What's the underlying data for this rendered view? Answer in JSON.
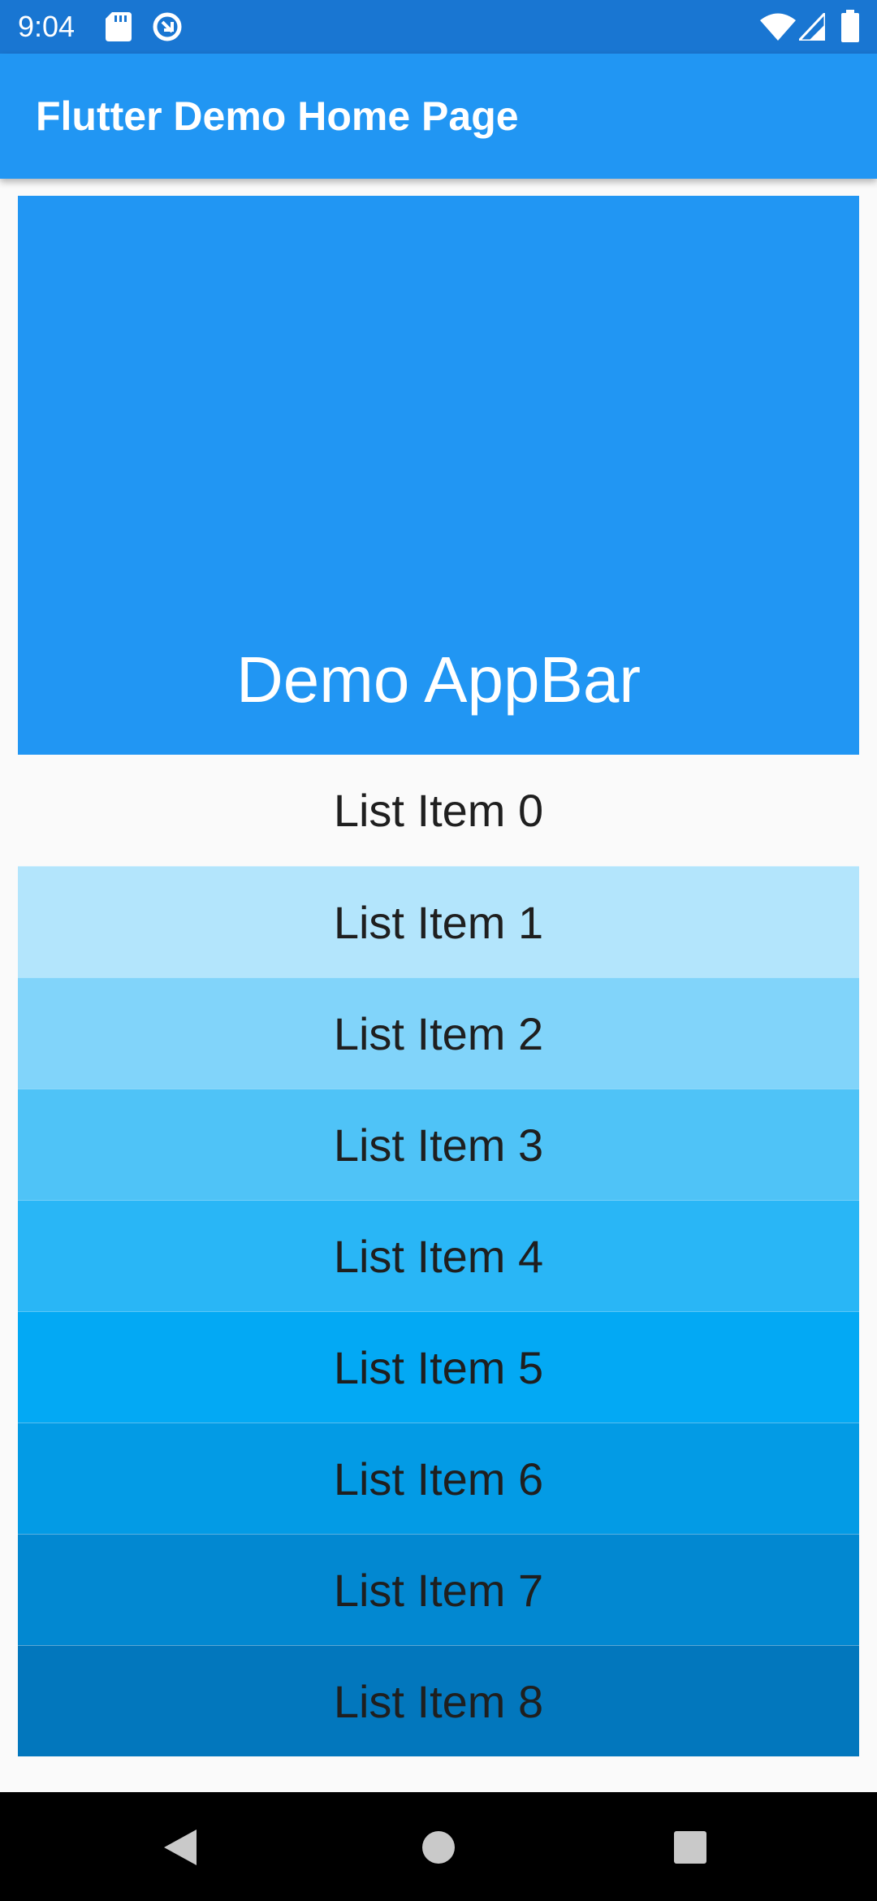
{
  "status_bar": {
    "time": "9:04",
    "icons": [
      "sd-card-icon",
      "data-saver-icon",
      "wifi-icon",
      "signal-icon",
      "battery-icon"
    ]
  },
  "app_bar": {
    "title": "Flutter Demo Home Page"
  },
  "header": {
    "title": "Demo AppBar"
  },
  "list": {
    "items": [
      {
        "label": "List Item 0",
        "color": "#fafafa"
      },
      {
        "label": "List Item 1",
        "color": "#b3e5fc"
      },
      {
        "label": "List Item 2",
        "color": "#81d4fa"
      },
      {
        "label": "List Item 3",
        "color": "#4fc3f7"
      },
      {
        "label": "List Item 4",
        "color": "#29b6f6"
      },
      {
        "label": "List Item 5",
        "color": "#03a9f4"
      },
      {
        "label": "List Item 6",
        "color": "#039be5"
      },
      {
        "label": "List Item 7",
        "color": "#0288d1"
      },
      {
        "label": "List Item 8",
        "color": "#0277bd"
      }
    ]
  },
  "colors": {
    "status_bar": "#1976d2",
    "app_bar": "#2196f3",
    "header": "#2196f3",
    "background": "#fafafa",
    "nav_bar": "#000000"
  },
  "nav_bar": {
    "icons": [
      "back-icon",
      "home-icon",
      "recents-icon"
    ]
  }
}
